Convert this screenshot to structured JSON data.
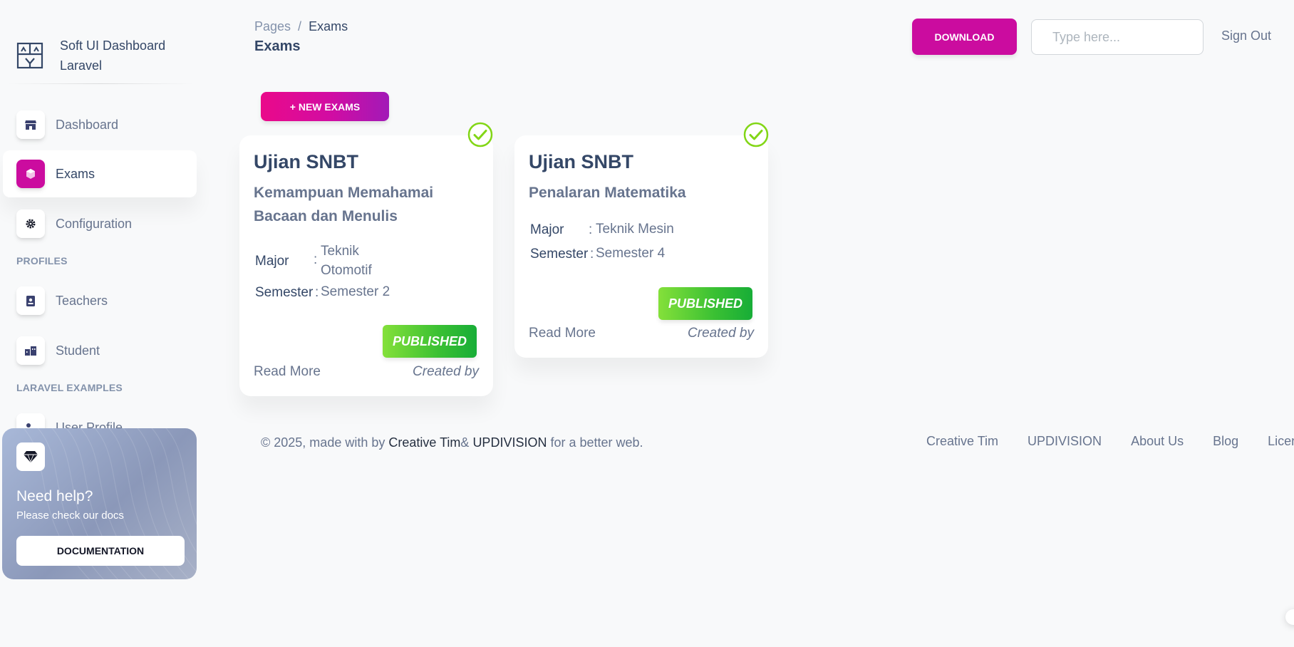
{
  "sidebar": {
    "brand": "Soft UI Dashboard Laravel",
    "items": [
      {
        "label": "Dashboard",
        "icon": "shop-icon"
      },
      {
        "label": "Exams",
        "icon": "cube-icon",
        "active": true
      },
      {
        "label": "Configuration",
        "icon": "gear-icon"
      },
      {
        "label": "Teachers",
        "icon": "badge-icon"
      },
      {
        "label": "Student",
        "icon": "building-icon"
      },
      {
        "label": "User Profile",
        "icon": "user-icon"
      }
    ],
    "sections": {
      "profiles": "PROFILES",
      "laravel_examples": "LARAVEL EXAMPLES"
    },
    "help": {
      "title": "Need help?",
      "subtitle": "Please check our docs",
      "button": "DOCUMENTATION",
      "icon": "diamond-icon"
    }
  },
  "header": {
    "breadcrumb": [
      "Pages",
      "/",
      "Exams"
    ],
    "title": "Exams",
    "download_label": "DOWNLOAD",
    "search_placeholder": "Type here...",
    "signout_label": "Sign Out"
  },
  "new_exams_label": "+ NEW EXAMS",
  "exams": [
    {
      "title": "Ujian SNBT",
      "subtitle_lines": [
        "Kemampuan Memahamai",
        "Bacaan dan Menulis"
      ],
      "major_label": "Major",
      "major_lines": [
        "Teknik",
        "Otomotif"
      ],
      "semester_label": "Semester",
      "semester": "Semester 2",
      "status": "PUBLISHED",
      "read_more": "Read More",
      "created_by": "Created by"
    },
    {
      "title": "Ujian SNBT",
      "subtitle_lines": [
        "Penalaran Matematika"
      ],
      "major_label": "Major",
      "major_lines": [
        "Teknik Mesin"
      ],
      "semester_label": "Semester",
      "semester": "Semester 4",
      "status": "PUBLISHED",
      "read_more": "Read More",
      "created_by": "Created by"
    }
  ],
  "footer": {
    "copy_prefix": "© 2025, made with by",
    "creative_tim": "Creative Tim",
    "amp": "&",
    "updivision": "UPDIVISION",
    "copy_suffix": "for a better web.",
    "links": [
      "Creative Tim",
      "UPDIVISION",
      "About Us",
      "Blog",
      "License"
    ]
  },
  "colors": {
    "primary": "#cb0c9f",
    "success": "#82d616",
    "text_dark": "#344767",
    "text_muted": "#67748e"
  }
}
